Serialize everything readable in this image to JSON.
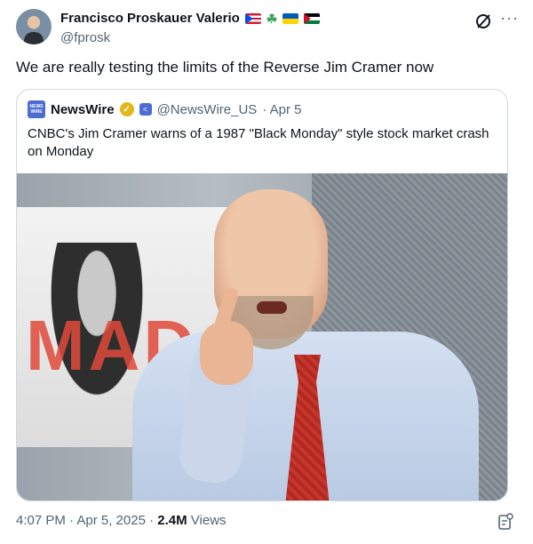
{
  "tweet": {
    "author_name": "Francisco Proskauer Valerio",
    "author_handle": "@fprosk",
    "text": "We are really testing the limits of the Reverse Jim Cramer now",
    "timestamp": "4:07 PM · Apr 5, 2025 ·",
    "views_count": "2.4M",
    "views_label": "Views",
    "icons": [
      "puerto-rico-flag",
      "shamrock",
      "ukraine-flag",
      "palestine-flag",
      "grok-icon",
      "more-icon",
      "bookmark-icon"
    ]
  },
  "quote": {
    "logo_text_top": "NEWS",
    "logo_text_bottom": "WIRE",
    "author_name": "NewsWire",
    "author_handle": "@NewsWire_US",
    "date": "· Apr 5",
    "text": "CNBC's Jim Cramer warns of a 1987 \"Black Monday\" style stock market crash on Monday"
  },
  "colors": {
    "text_primary": "#0f1419",
    "text_secondary": "#536471",
    "border": "#cfd9de",
    "verified_gold": "#e2b719"
  }
}
